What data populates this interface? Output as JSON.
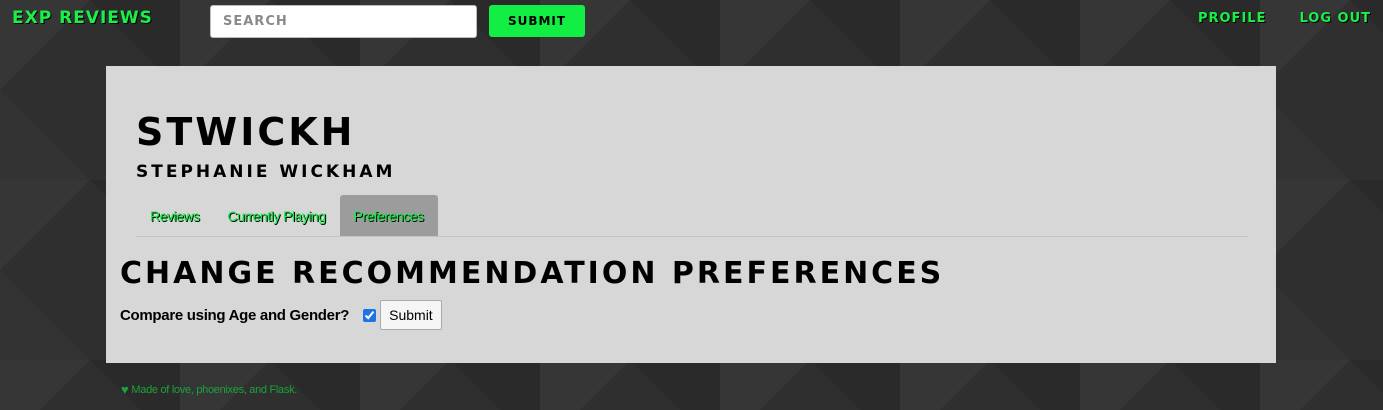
{
  "header": {
    "brand": "EXP REVIEWS",
    "search_placeholder": "SEARCH",
    "submit_label": "SUBMIT",
    "nav": [
      {
        "label": "PROFILE"
      },
      {
        "label": "LOG OUT"
      }
    ]
  },
  "profile": {
    "username": "STWICKH",
    "full_name": "STEPHANIE WICKHAM",
    "tabs": [
      {
        "label": "Reviews",
        "active": false
      },
      {
        "label": "Currently Playing",
        "active": false
      },
      {
        "label": "Preferences",
        "active": true
      }
    ]
  },
  "preferences": {
    "heading": "CHANGE RECOMMENDATION PREFERENCES",
    "compare_label": "Compare using Age and Gender?",
    "compare_checked": true,
    "submit_label": "Submit"
  },
  "footer": {
    "icon": "heart-icon",
    "text": "Made of love, phoenixes, and Flask."
  },
  "colors": {
    "accent_green": "#12ee44",
    "panel_bg": "#d7d7d7",
    "page_bg": "#2f2f2f",
    "active_tab_bg": "#9c9c9c"
  }
}
